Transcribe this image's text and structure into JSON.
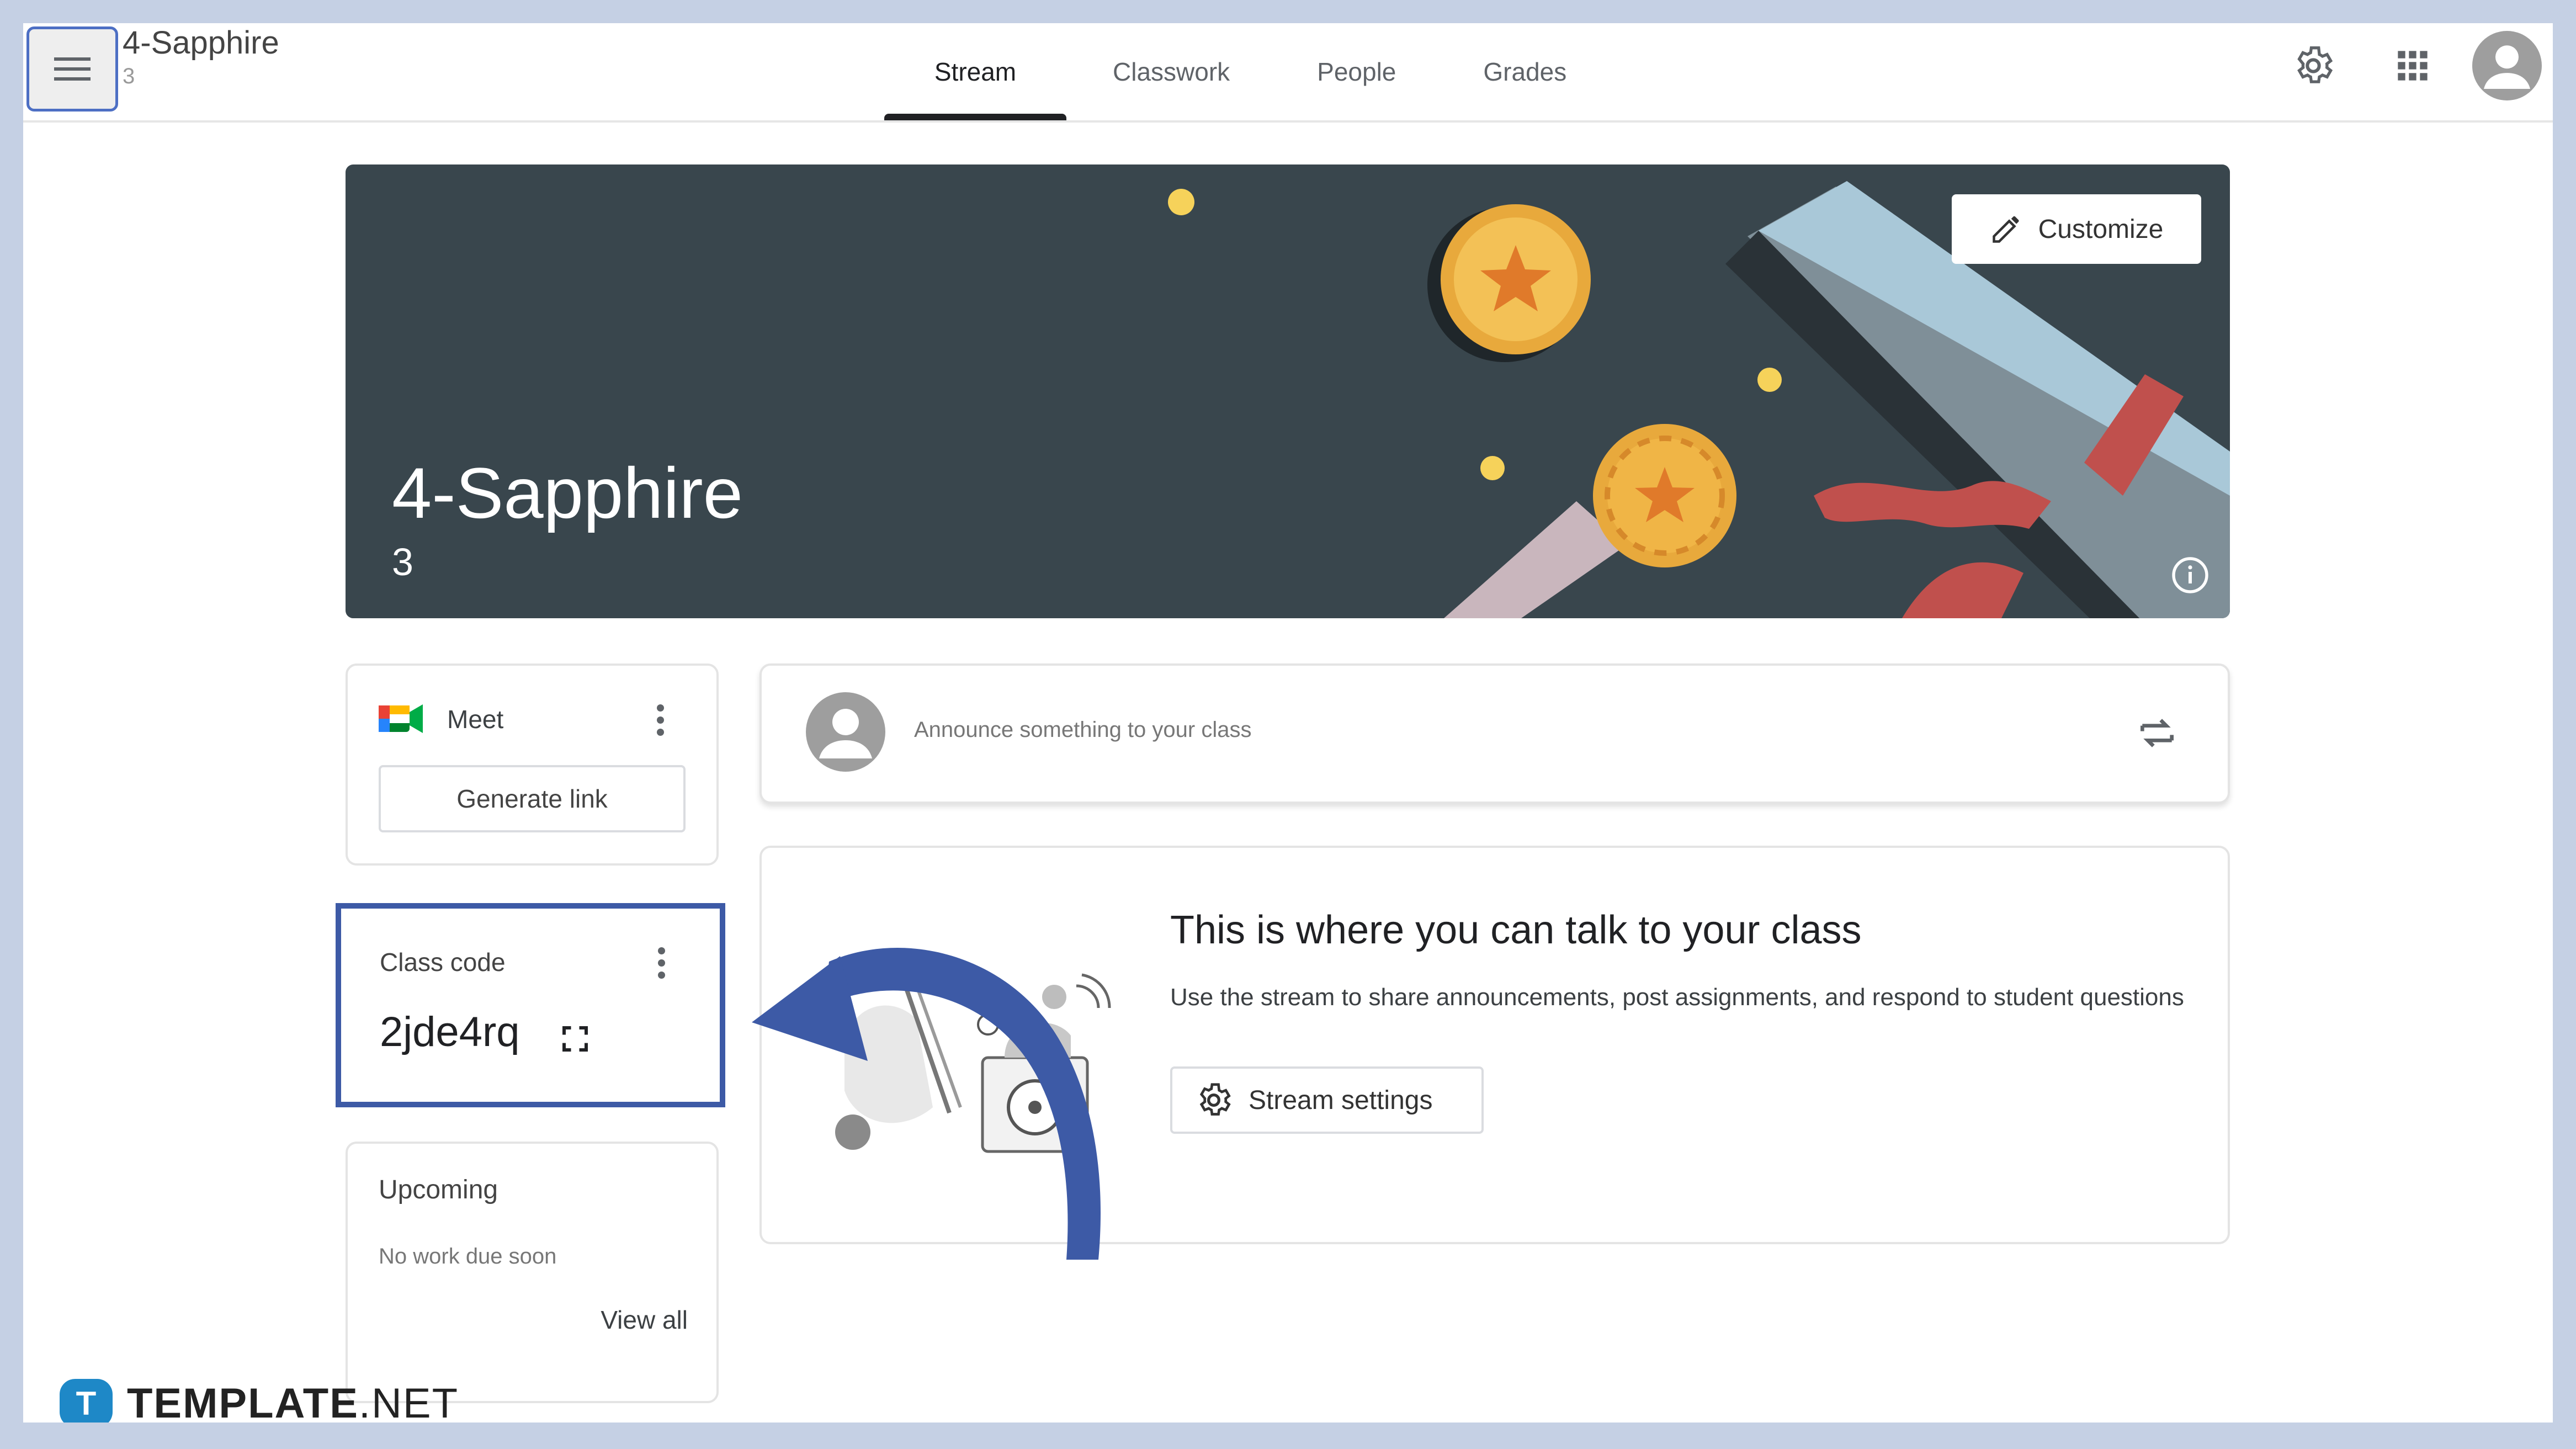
{
  "header": {
    "class_name": "4-Sapphire",
    "class_section": "3",
    "tabs": [
      {
        "label": "Stream",
        "active": true
      },
      {
        "label": "Classwork",
        "active": false
      },
      {
        "label": "People",
        "active": false
      },
      {
        "label": "Grades",
        "active": false
      }
    ]
  },
  "banner": {
    "title": "4-Sapphire",
    "subtitle": "3",
    "customize_label": "Customize"
  },
  "meet": {
    "label": "Meet",
    "generate_link_label": "Generate link"
  },
  "class_code": {
    "label": "Class code",
    "value": "2jde4rq"
  },
  "upcoming": {
    "label": "Upcoming",
    "empty_text": "No work due soon",
    "view_all_label": "View all"
  },
  "announce": {
    "placeholder": "Announce something to your class"
  },
  "talk": {
    "title": "This is where you can talk to your class",
    "description": "Use the stream to share announcements, post assignments, and respond to student questions",
    "stream_settings_label": "Stream settings"
  },
  "watermark": {
    "brand_bold": "TEMPLATE",
    "brand_suffix": ".NET"
  },
  "colors": {
    "banner_bg": "#39464d",
    "highlight": "#3d5aa6",
    "frame_bg": "#c5d0e4"
  }
}
